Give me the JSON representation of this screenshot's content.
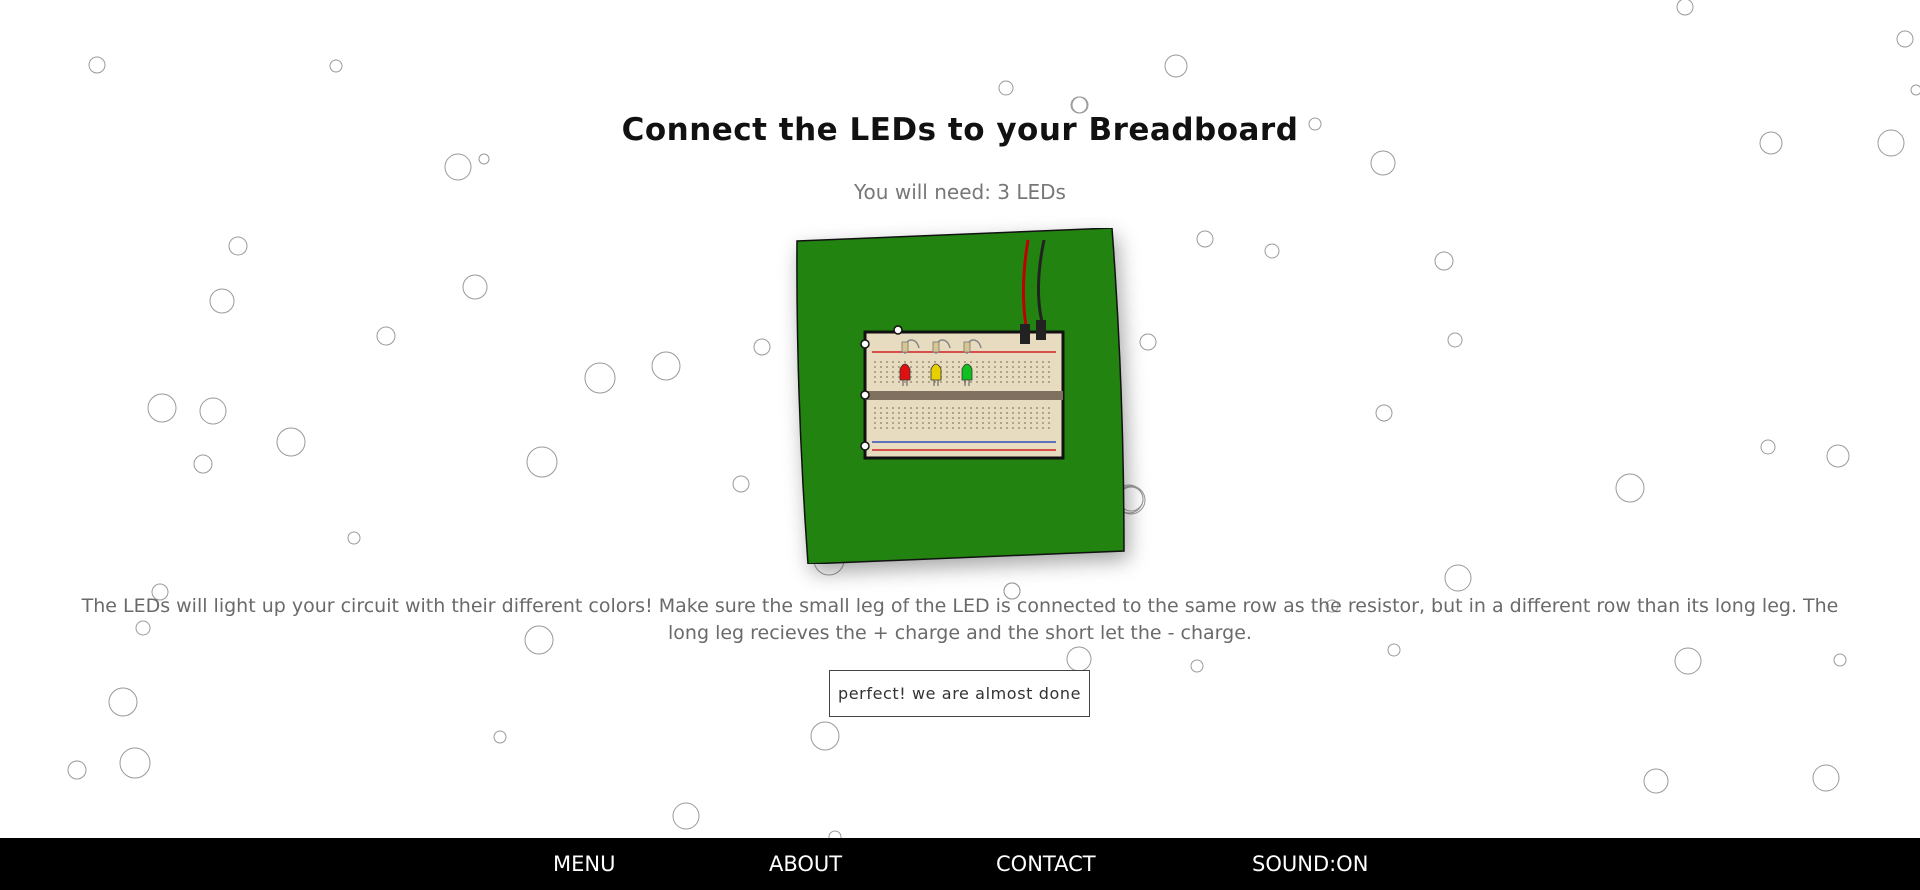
{
  "page": {
    "title": "Connect the LEDs to your Breadboard",
    "need": "You will need: 3 LEDs",
    "description": "The LEDs will light up your circuit with their different colors! Make sure the small leg of the LED is connected to the same row as the resistor, but in a different row than its long leg. The long leg recieves the + charge and the short let the - charge.",
    "next_button": "perfect! we are almost done"
  },
  "illustration": {
    "background_color": "#238310",
    "led_colors": [
      "#e01010",
      "#e8d000",
      "#10c020"
    ],
    "wire_colors": [
      "#c00000",
      "#222222"
    ]
  },
  "nav": {
    "menu": "MENU",
    "about": "ABOUT",
    "contact": "CONTACT",
    "sound": "SOUND:ON"
  }
}
